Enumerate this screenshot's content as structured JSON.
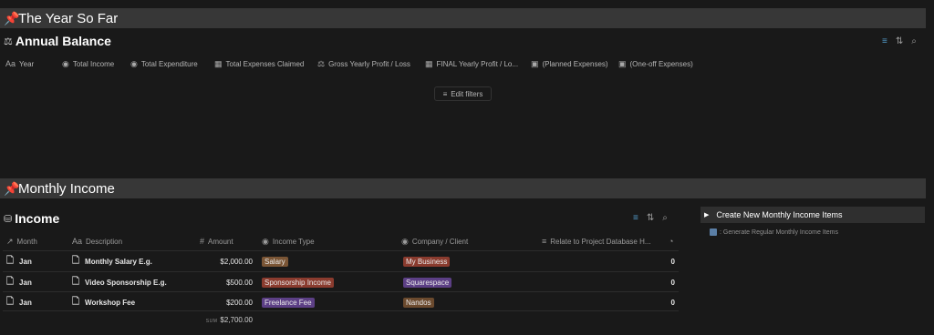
{
  "sections": {
    "year_so_far": "The Year So Far",
    "monthly_income": "Monthly Income"
  },
  "annual_balance": {
    "title": "Annual Balance",
    "icon": "scales-icon",
    "properties": [
      {
        "icon": "Aa",
        "label": "Year"
      },
      {
        "icon": "◉",
        "label": "Total Income"
      },
      {
        "icon": "◉",
        "label": "Total Expenditure"
      },
      {
        "icon": "▦",
        "label": "Total Expenses Claimed"
      },
      {
        "icon": "⚖",
        "label": "Gross Yearly Profit / Loss"
      },
      {
        "icon": "▦",
        "label": "FINAL Yearly Profit / Lo..."
      },
      {
        "icon": "▣",
        "label": "(Planned Expenses)"
      },
      {
        "icon": "▣",
        "label": "(One-off Expenses)"
      }
    ],
    "edit_filters": "Edit filters"
  },
  "income": {
    "title": "Income",
    "icon": "coins-icon",
    "columns": {
      "month": "Month",
      "description": "Description",
      "amount": "Amount",
      "income_type": "Income Type",
      "company": "Company / Client",
      "relate": "Relate to Project Database H..."
    },
    "rows": [
      {
        "month": "Jan",
        "description": "Monthly Salary E.g.",
        "amount": "$2,000.00",
        "type": "Salary",
        "company": "My Business",
        "count": "0"
      },
      {
        "month": "Jan",
        "description": "Video Sponsorship E.g.",
        "amount": "$500.00",
        "type": "Sponsorship Income",
        "company": "Squarespace",
        "count": "0"
      },
      {
        "month": "Jan",
        "description": "Workshop Fee",
        "amount": "$200.00",
        "type": "Freelance Fee",
        "company": "Nandos",
        "count": "0"
      }
    ],
    "sum_label": "SUM",
    "sum_value": "$2,700.00"
  },
  "tag_colors": {
    "Salary": "#7a5535",
    "Sponsorship Income": "#8a3b2e",
    "Freelance Fee": "#5c3f85",
    "My Business": "#8a3b2e",
    "Squarespace": "#5c3f85",
    "Nandos": "#6b4a2e"
  },
  "side_panel": {
    "toggle_label": "Create New Monthly Income Items",
    "button_label": ": Generate Regular Monthly Income Items"
  }
}
